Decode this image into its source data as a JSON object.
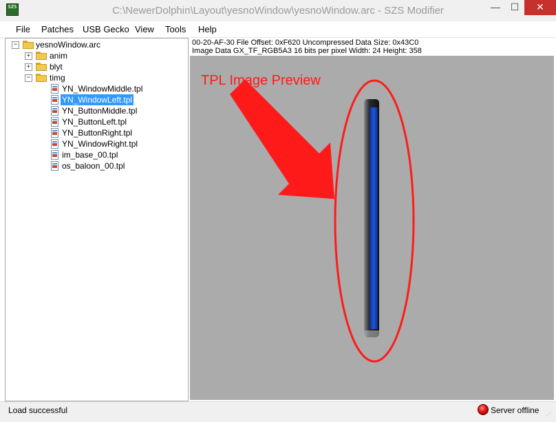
{
  "window": {
    "title": "C:\\NewerDolphin\\Layout\\yesnoWindow\\yesnoWindow.arc - SZS Modifier",
    "app_icon_text": "SZS",
    "minimize_glyph": "—",
    "maximize_glyph": "☐",
    "close_glyph": "✕"
  },
  "menu": {
    "items": [
      "File",
      "Patches",
      "USB Gecko",
      "View",
      "Tools",
      "Help"
    ]
  },
  "tree": {
    "root": "yesnoWindow.arc",
    "folders": [
      "anim",
      "blyt",
      "timg"
    ],
    "files": [
      "YN_WindowMiddle.tpl",
      "YN_WindowLeft.tpl",
      "YN_ButtonMiddle.tpl",
      "YN_ButtonLeft.tpl",
      "YN_ButtonRight.tpl",
      "YN_WindowRight.tpl",
      "im_base_00.tpl",
      "os_baloon_00.tpl"
    ],
    "selected_file": "YN_WindowLeft.tpl",
    "expander_plus": "+",
    "expander_minus": "−"
  },
  "file_info": {
    "line1": "00-20-AF-30 File Offset: 0xF620 Uncompressed Data Size: 0x43C0",
    "line2": "Image Data GX_TF_RGB5A3 16 bits per pixel Width: 24 Height: 358"
  },
  "preview": {
    "caption": "TPL Image Preview",
    "annotation_color": "#ff1a1a",
    "background_color": "#ababab"
  },
  "status": {
    "left_text": "Load successful",
    "right_text": "Server offline",
    "indicator": "red-led-icon"
  }
}
